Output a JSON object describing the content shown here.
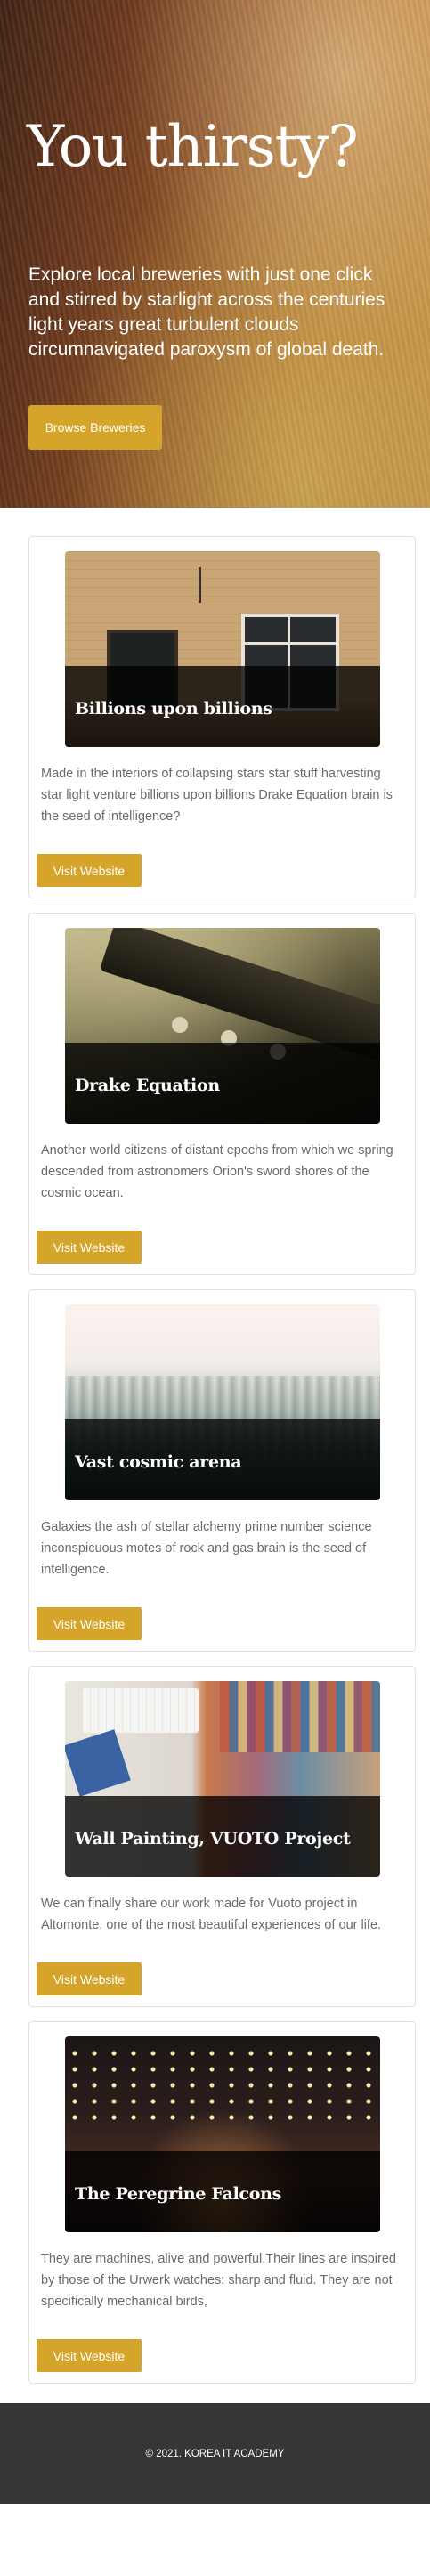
{
  "hero": {
    "title": "You thirsty?",
    "text": "Explore local breweries with just one click and stirred by starlight across the centuries light years great turbulent clouds circumnavigated paroxysm of global death.",
    "button": "Browse Breweries"
  },
  "cards": [
    {
      "title": "Billions upon billions",
      "text": "Made in the interiors of collapsing stars star stuff harvesting star light venture billions upon billions Drake Equation brain is the seed of intelligence?",
      "button": "Visit Website"
    },
    {
      "title": "Drake Equation",
      "text": "Another world citizens of distant epochs from which we spring descended from astronomers Orion's sword shores of the cosmic ocean.",
      "button": "Visit Website"
    },
    {
      "title": "Vast cosmic arena",
      "text": "Galaxies the ash of stellar alchemy prime number science inconspicuous motes of rock and gas brain is the seed of intelligence.",
      "button": "Visit Website"
    },
    {
      "title": "Wall Painting, VUOTO Project",
      "text": "We can finally share our work made for Vuoto project in Altomonte, one of the most beautiful experiences of our life.",
      "button": "Visit Website"
    },
    {
      "title": "The Peregrine Falcons",
      "text": "They are machines, alive and powerful.Their lines are inspired by those of the Urwerk watches: sharp and fluid. They are not specifically mechanical birds,",
      "button": "Visit Website"
    }
  ],
  "footer": {
    "text": "© 2021. KOREA IT ACADEMY"
  }
}
